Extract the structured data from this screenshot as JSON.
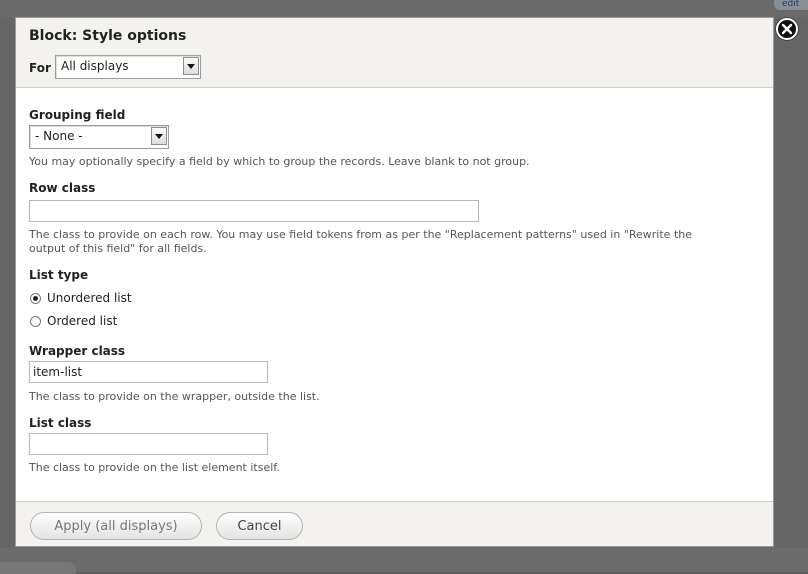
{
  "background": {
    "edit_tab": "edit"
  },
  "dialog": {
    "title": "Block: Style options",
    "for_label": "For",
    "for_value": "All displays",
    "close_icon": "close-icon"
  },
  "fields": {
    "grouping": {
      "label": "Grouping field",
      "value": "- None -",
      "description": "You may optionally specify a field by which to group the records. Leave blank to not group."
    },
    "row_class": {
      "label": "Row class",
      "value": "",
      "description_line1": "The class to provide on each row. You may use field tokens from as per the \"Replacement patterns\" used in \"Rewrite the",
      "description_line2": "output of this field\" for all fields."
    },
    "list_type": {
      "label": "List type",
      "options": [
        "Unordered list",
        "Ordered list"
      ],
      "selected": "Unordered list"
    },
    "wrapper_class": {
      "label": "Wrapper class",
      "value": "item-list",
      "description": "The class to provide on the wrapper, outside the list."
    },
    "list_class": {
      "label": "List class",
      "value": "",
      "description": "The class to provide on the list element itself."
    }
  },
  "footer": {
    "apply_label": "Apply (all displays)",
    "cancel_label": "Cancel"
  }
}
